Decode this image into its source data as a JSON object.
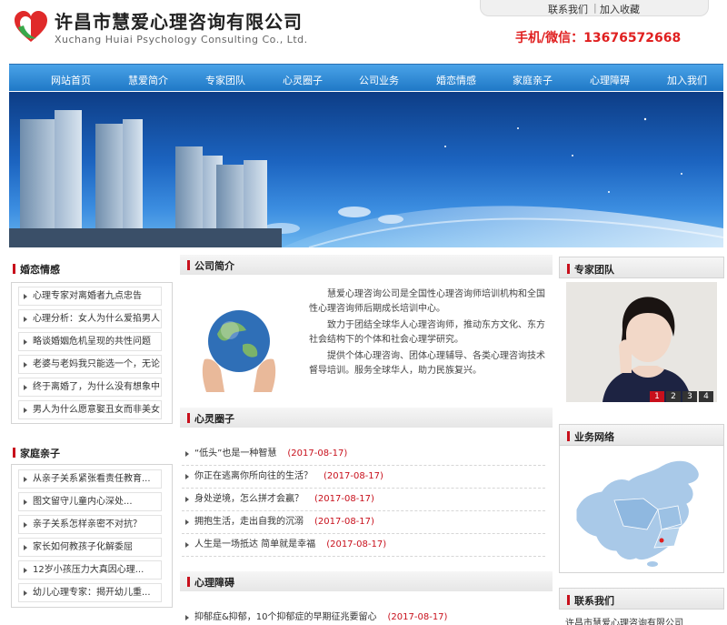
{
  "header": {
    "company_name": "许昌市慧爱心理咨询有限公司",
    "company_name_en": "Xuchang Huiai Psychology Consulting Co., Ltd.",
    "top_links": [
      "联系我们",
      "加入收藏"
    ],
    "phone_text": "手机/微信：13676572668"
  },
  "nav": {
    "items": [
      "网站首页",
      "慧爱简介",
      "专家团队",
      "心灵圈子",
      "公司业务",
      "婚恋情感",
      "家庭亲子",
      "心理障碍",
      "加入我们"
    ]
  },
  "left": {
    "marriage": {
      "title": "婚恋情感",
      "items": [
        "心理专家对离婚者九点忠告",
        "心理分析：女人为什么爱掐男人...",
        "略谈婚姻危机呈现的共性问题",
        "老婆与老妈我只能选一个，无论...",
        "终于离婚了，为什么没有想象中...",
        "男人为什么愿意娶丑女而非美女..."
      ]
    },
    "family": {
      "title": "家庭亲子",
      "items": [
        "从亲子关系紧张看责任教育...",
        "图文留守儿童内心深处...",
        "亲子关系怎样亲密不对抗？",
        "家长如何教孩子化解委屈",
        "12岁小孩压力大真因心理...",
        "幼儿心理专家：揭开幼儿重..."
      ]
    }
  },
  "main": {
    "about": {
      "title": "公司简介",
      "paragraphs": [
        "慧爱心理咨询公司是全国性心理咨询师培训机构和全国性心理咨询师后期成长培训中心。",
        "致力于团结全球华人心理咨询师，推动东方文化、东方社会结构下的个体和社会心理学研究。",
        "提供个体心理咨询、团体心理辅导、各类心理咨询技术督导培训。服务全球华人，助力民族复兴。"
      ]
    },
    "soul": {
      "title": "心灵圈子",
      "articles": [
        {
          "title": "“低头”也是一种智慧",
          "date": "(2017-08-17)"
        },
        {
          "title": "你正在逃离你所向往的生活？",
          "date": "(2017-08-17)"
        },
        {
          "title": "身处逆境，怎么拼才会赢？",
          "date": "(2017-08-17)"
        },
        {
          "title": "拥抱生活，走出自我的沉溺",
          "date": "(2017-08-17)"
        },
        {
          "title": "人生是一场抵达 简单就是幸福",
          "date": "(2017-08-17)"
        }
      ]
    },
    "disorder": {
      "title": "心理障碍",
      "articles": [
        {
          "title": "抑郁症&抑郁，10个抑郁症的早期征兆要留心",
          "date": "(2017-08-17)"
        }
      ]
    }
  },
  "right": {
    "experts": {
      "title": "专家团队",
      "pager": [
        "1",
        "2",
        "3",
        "4"
      ],
      "active_page": "1"
    },
    "network": {
      "title": "业务网络"
    },
    "contact": {
      "title": "联系我们",
      "company": "许昌市慧爱心理咨询有限公司"
    }
  },
  "colors": {
    "accent_red": "#c8101c",
    "nav_blue": "#1f78c6",
    "phone_red": "#e02020"
  }
}
